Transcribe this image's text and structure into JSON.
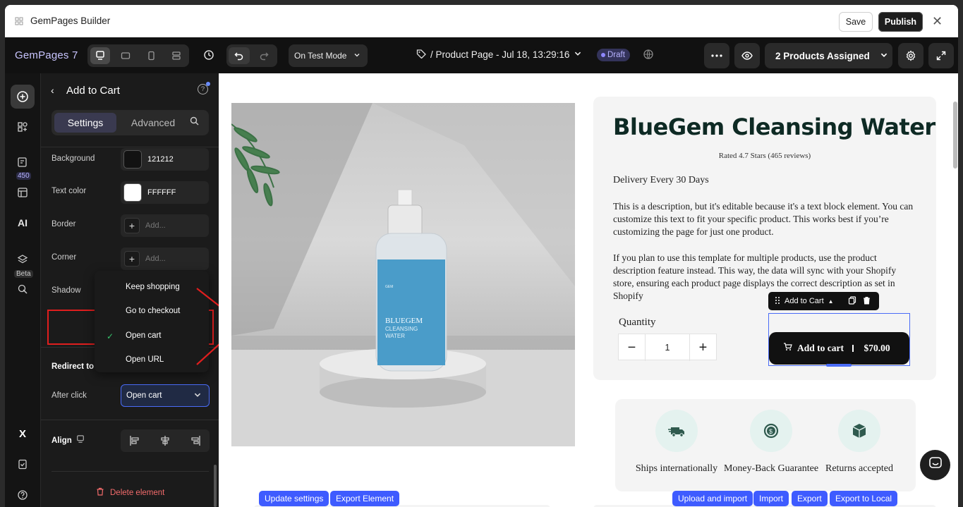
{
  "window": {
    "title": "GemPages Builder",
    "save": "Save",
    "publish": "Publish"
  },
  "topbar": {
    "brand": "GemPages 7",
    "mode": "On Test Mode",
    "page": "/ Product Page - Jul 18, 13:29:16",
    "status": "Draft",
    "assigned": "2 Products Assigned"
  },
  "rail": {
    "badge": "450",
    "beta": "Beta",
    "ai": "AI"
  },
  "panel": {
    "title": "Add to Cart",
    "tabs": [
      "Settings",
      "Advanced"
    ],
    "background": {
      "label": "Background",
      "value": "121212",
      "color": "#121212"
    },
    "text_color": {
      "label": "Text color",
      "value": "FFFFFF",
      "color": "#FFFFFF"
    },
    "border": {
      "label": "Border",
      "placeholder": "Add..."
    },
    "corner": {
      "label": "Corner",
      "placeholder": "Add..."
    },
    "shadow": {
      "label": "Shadow"
    },
    "redirect": "Redirect to",
    "after_click": {
      "label": "After click",
      "value": "Open cart"
    },
    "dropdown": [
      "Keep shopping",
      "Go to checkout",
      "Open cart",
      "Open URL"
    ],
    "align": "Align",
    "delete": "Delete element"
  },
  "product": {
    "title": "BlueGem Cleansing Water",
    "rating": "Rated 4.7 Stars (465 reviews)",
    "delivery": "Delivery Every 30 Days",
    "desc1": "This is a description, but it's editable because it's a text block element. You can customize this text to fit your specific product. This works best if you’re customizing the page for just one product.",
    "desc2": "If you plan to use this template for multiple products, use the product description feature instead. This way, the data will sync with your Shopify store, ensuring each product page displays the correct description as set in Shopify",
    "qty_label": "Quantity",
    "qty": "1",
    "atc_toolbar": "Add to Cart",
    "atc": "Add to cart",
    "price": "$70.00",
    "bottle_brand": "BLUEGEM",
    "bottle_sub1": "CLEANSING",
    "bottle_sub2": "WATER",
    "bottle_logo": "GEM"
  },
  "features": [
    "Ships internationally",
    "Money-Back Guarantee",
    "Returns accepted"
  ],
  "actions": {
    "left": [
      "Update settings",
      "Export Element"
    ],
    "right": [
      "Upload and import",
      "Import",
      "Export",
      "Export to Local"
    ]
  },
  "colors": {
    "accent": "#4a6cf7",
    "danger": "#e01e1e",
    "green": "#36c46c"
  }
}
